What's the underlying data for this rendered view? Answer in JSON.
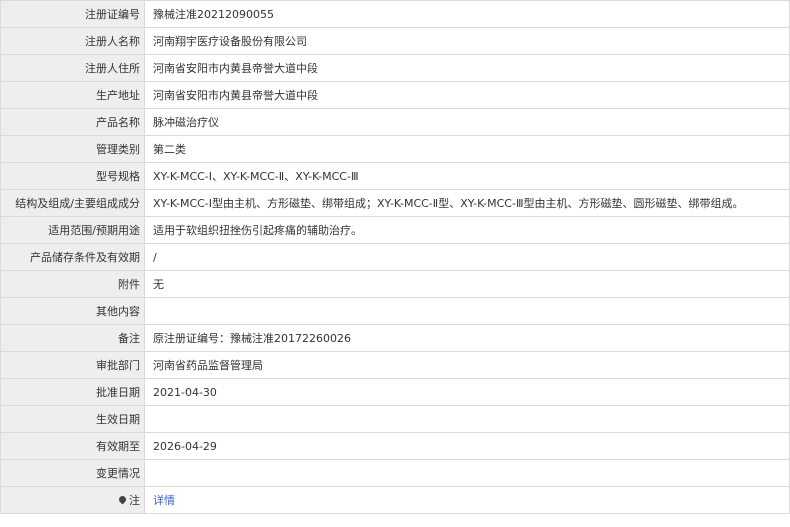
{
  "rows": [
    {
      "label": "注册证编号",
      "value": "豫械注准20212090055"
    },
    {
      "label": "注册人名称",
      "value": "河南翔宇医疗设备股份有限公司"
    },
    {
      "label": "注册人住所",
      "value": "河南省安阳市内黄县帝誉大道中段"
    },
    {
      "label": "生产地址",
      "value": "河南省安阳市内黄县帝誉大道中段"
    },
    {
      "label": "产品名称",
      "value": "脉冲磁治疗仪"
    },
    {
      "label": "管理类别",
      "value": "第二类"
    },
    {
      "label": "型号规格",
      "value": "XY-K-MCC-Ⅰ、XY-K-MCC-Ⅱ、XY-K-MCC-Ⅲ"
    },
    {
      "label": "结构及组成/主要组成成分",
      "value": "XY-K-MCC-Ⅰ型由主机、方形磁垫、绑带组成；XY-K-MCC-Ⅱ型、XY-K-MCC-Ⅲ型由主机、方形磁垫、圆形磁垫、绑带组成。"
    },
    {
      "label": "适用范围/预期用途",
      "value": "适用于软组织扭挫伤引起疼痛的辅助治疗。"
    },
    {
      "label": "产品储存条件及有效期",
      "value": "/"
    },
    {
      "label": "附件",
      "value": "无"
    },
    {
      "label": "其他内容",
      "value": ""
    },
    {
      "label": "备注",
      "value": "原注册证编号：豫械注准20172260026"
    },
    {
      "label": "审批部门",
      "value": "河南省药品监督管理局"
    },
    {
      "label": "批准日期",
      "value": "2021-04-30"
    },
    {
      "label": "生效日期",
      "value": ""
    },
    {
      "label": "有效期至",
      "value": "2026-04-29"
    },
    {
      "label": "变更情况",
      "value": ""
    }
  ],
  "note_row": {
    "label": "注",
    "icon": "map-pin-icon",
    "link_text": "详情",
    "link_color": "#3366cc"
  }
}
